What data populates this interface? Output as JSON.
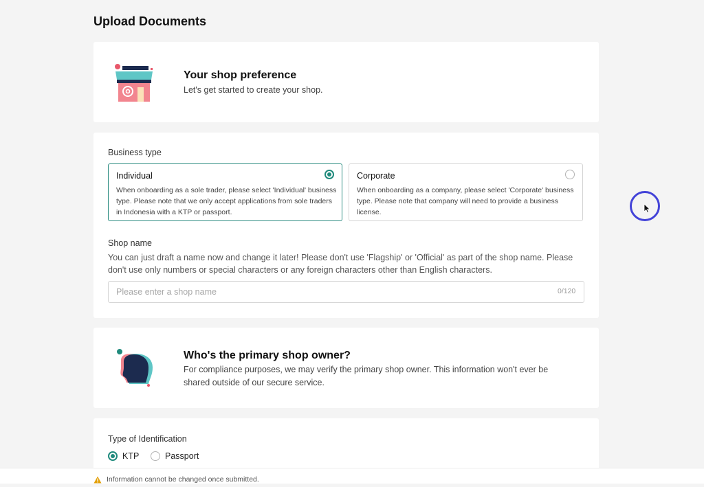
{
  "page": {
    "title": "Upload Documents"
  },
  "shop_preference": {
    "title": "Your shop preference",
    "subtitle": "Let's get started to create your shop.",
    "icon": "storefront-icon"
  },
  "business": {
    "label": "Business type",
    "options": [
      {
        "title": "Individual",
        "description": "When onboarding as a sole trader, please select 'Individual' business type. Please note that we only accept applications from sole traders in Indonesia with a KTP or passport.",
        "selected": true
      },
      {
        "title": "Corporate",
        "description": "When onboarding as a company, please select 'Corporate' business type. Please note that company will need to provide a business license.",
        "selected": false
      }
    ],
    "shop_name": {
      "label": "Shop name",
      "help": "You can just draft a name now and change it later! Please don't use 'Flagship' or 'Official' as part of the shop name. Please don't use only numbers or special characters or any foreign characters other than English characters.",
      "placeholder": "Please enter a shop name",
      "value": "",
      "counter": "0/120"
    }
  },
  "owner": {
    "title": "Who's the primary shop owner?",
    "subtitle": "For compliance purposes, we may verify the primary shop owner. This information won't ever be shared outside of our secure service.",
    "icon": "person-profile-icon"
  },
  "identification": {
    "label": "Type of Identification",
    "options": [
      {
        "label": "KTP",
        "selected": true
      },
      {
        "label": "Passport",
        "selected": false
      }
    ]
  },
  "footer": {
    "warning": "Information cannot be changed once submitted.",
    "icon": "warning-icon"
  },
  "colors": {
    "accent": "#1f8a7c",
    "background": "#f4f4f4",
    "cursor_ring": "#4343d8"
  }
}
